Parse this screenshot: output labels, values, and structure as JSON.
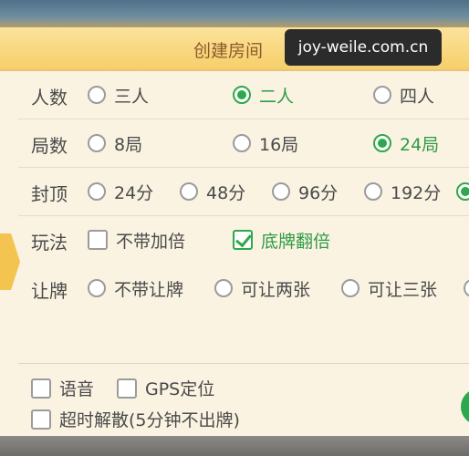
{
  "dialog": {
    "title": "创建房间",
    "watermark": "joy-weile.com.cn"
  },
  "rows": {
    "players": {
      "label": "人数",
      "options": [
        {
          "text": "三人",
          "selected": false
        },
        {
          "text": "二人",
          "selected": true
        },
        {
          "text": "四人",
          "selected": false
        }
      ]
    },
    "rounds": {
      "label": "局数",
      "options": [
        {
          "text": "8局",
          "selected": false
        },
        {
          "text": "16局",
          "selected": false
        },
        {
          "text": "24局",
          "selected": true
        }
      ]
    },
    "cap": {
      "label": "封顶",
      "options": [
        {
          "text": "24分",
          "selected": false
        },
        {
          "text": "48分",
          "selected": false
        },
        {
          "text": "96分",
          "selected": false
        },
        {
          "text": "192分",
          "selected": false
        }
      ]
    },
    "play": {
      "label": "玩法",
      "options": [
        {
          "text": "不带加倍",
          "checked": false
        },
        {
          "text": "底牌翻倍",
          "checked": true
        }
      ]
    },
    "concede": {
      "label": "让牌",
      "options": [
        {
          "text": "不带让牌",
          "selected": false
        },
        {
          "text": "可让两张",
          "selected": false
        },
        {
          "text": "可让三张",
          "selected": false
        }
      ]
    }
  },
  "extras": {
    "voice": {
      "text": "语音",
      "checked": false
    },
    "gps": {
      "text": "GPS定位",
      "checked": false
    },
    "timeout": {
      "text": "超时解散(5分钟不出牌)",
      "checked": false
    }
  },
  "colors": {
    "accent_green": "#2ea84c",
    "header_gold": "#f7cf6a",
    "panel_bg": "#faf3e2"
  }
}
